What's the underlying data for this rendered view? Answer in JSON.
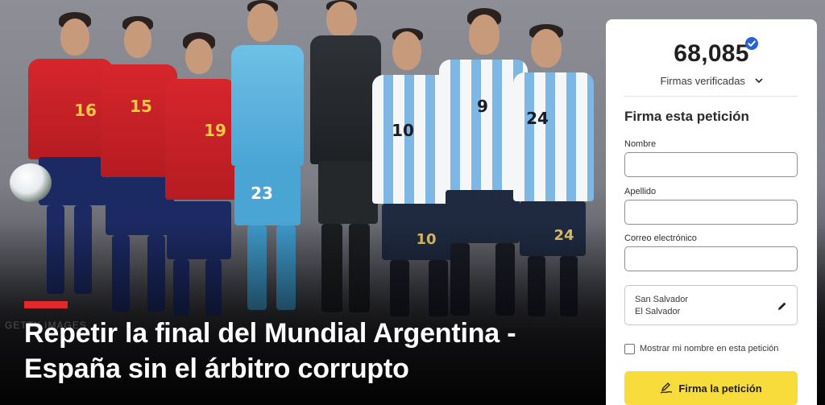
{
  "hero": {
    "watermark": "GETTY IMAGES",
    "title_line1": "Repetir la final del Mundial Argentina -",
    "title_line2": "España sin el árbitro corrupto",
    "players": [
      {
        "team": "spain",
        "number": "16"
      },
      {
        "team": "spain",
        "number": "15"
      },
      {
        "team": "spain",
        "number": "19"
      },
      {
        "team": "gk1",
        "number": "23"
      },
      {
        "team": "gk2",
        "number": ""
      },
      {
        "team": "arg",
        "number": "10"
      },
      {
        "team": "arg",
        "number": "9"
      },
      {
        "team": "arg",
        "number": "24"
      }
    ]
  },
  "panel": {
    "signature_count": "68,085",
    "signatures_label": "Firmas verificadas",
    "form_title": "Firma esta petición",
    "fields": {
      "first_name_label": "Nombre",
      "first_name_value": "",
      "last_name_label": "Apellido",
      "last_name_value": "",
      "email_label": "Correo electrónico",
      "email_value": ""
    },
    "location": {
      "city": "San Salvador",
      "country": "El Salvador"
    },
    "show_name_label": "Mostrar mi nombre en esta petición",
    "show_name_checked": false,
    "sign_button_label": "Firma la petición"
  },
  "colors": {
    "accent_red": "#e22828",
    "button_yellow": "#f7dc3c",
    "verified_blue": "#2a63d4"
  },
  "icons": [
    "verified-badge-icon",
    "chevron-down-icon",
    "pencil-edit-icon",
    "pen-signature-icon"
  ]
}
